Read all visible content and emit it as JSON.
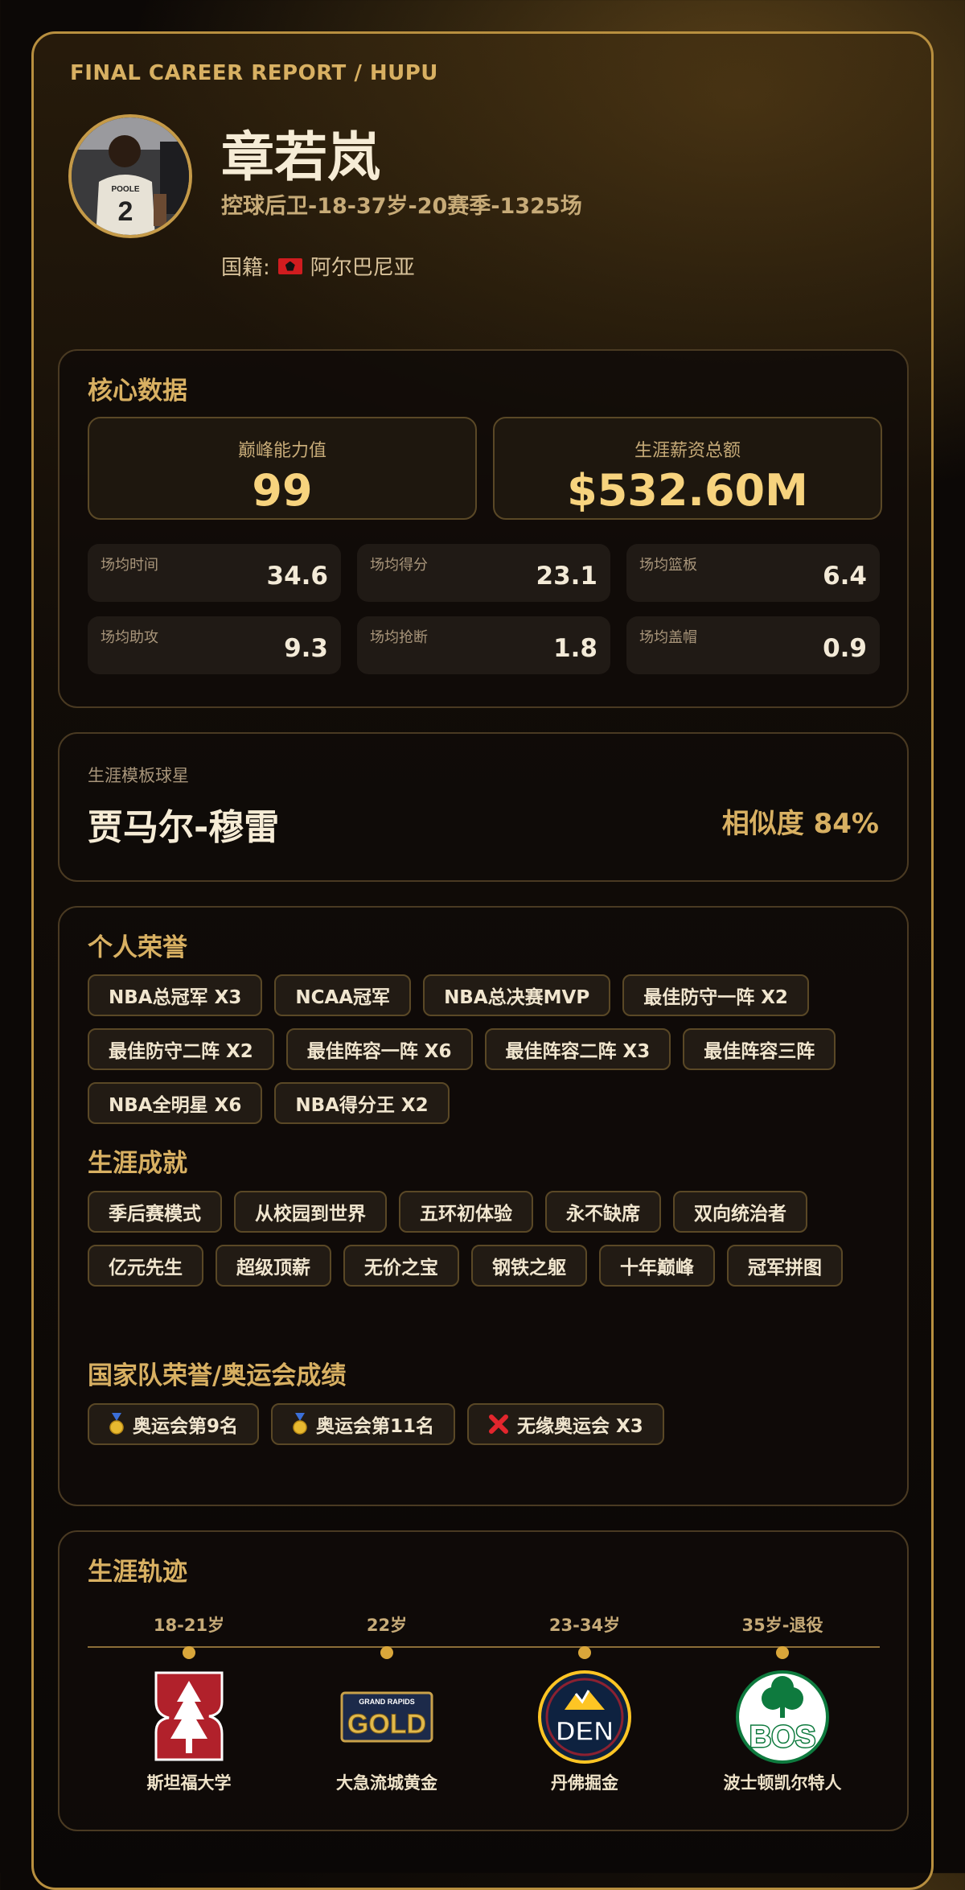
{
  "header": {
    "kicker": "FINAL CAREER REPORT / HUPU",
    "player_name": "章若岚",
    "subtitle": "控球后卫-18-37岁-20赛季-1325场",
    "nationality_label": "国籍:",
    "nationality": "阿尔巴尼亚",
    "avatar_jersey_name": "POOLE",
    "avatar_jersey_number": "2"
  },
  "core": {
    "title": "核心数据",
    "peak_label": "巅峰能力值",
    "peak_value": "99",
    "salary_label": "生涯薪资总额",
    "salary_value": "$532.60M",
    "stats": [
      {
        "label": "场均时间",
        "value": "34.6"
      },
      {
        "label": "场均得分",
        "value": "23.1"
      },
      {
        "label": "场均篮板",
        "value": "6.4"
      },
      {
        "label": "场均助攻",
        "value": "9.3"
      },
      {
        "label": "场均抢断",
        "value": "1.8"
      },
      {
        "label": "场均盖帽",
        "value": "0.9"
      }
    ]
  },
  "template": {
    "label": "生涯模板球星",
    "player": "贾马尔-穆雷",
    "similarity": "相似度 84%"
  },
  "honors": {
    "title": "个人荣誉",
    "items": [
      "NBA总冠军 X3",
      "NCAA冠军",
      "NBA总决赛MVP",
      "最佳防守一阵 X2",
      "最佳防守二阵 X2",
      "最佳阵容一阵 X6",
      "最佳阵容二阵 X3",
      "最佳阵容三阵",
      "NBA全明星 X6",
      "NBA得分王 X2"
    ]
  },
  "achievements": {
    "title": "生涯成就",
    "items": [
      "季后赛模式",
      "从校园到世界",
      "五环初体验",
      "永不缺席",
      "双向统治者",
      "亿元先生",
      "超级顶薪",
      "无价之宝",
      "钢铁之躯",
      "十年巅峰",
      "冠军拼图"
    ]
  },
  "national": {
    "title": "国家队荣誉/奥运会成绩",
    "items": [
      {
        "icon": "medal-icon",
        "text": "奥运会第9名"
      },
      {
        "icon": "medal-icon",
        "text": "奥运会第11名"
      },
      {
        "icon": "cross-icon",
        "text": "无缘奥运会 X3"
      }
    ]
  },
  "career": {
    "title": "生涯轨迹",
    "stops": [
      {
        "age": "18-21岁",
        "team": "斯坦福大学",
        "logo": "stanford-logo",
        "logo_text": "S"
      },
      {
        "age": "22岁",
        "team": "大急流城黄金",
        "logo": "grand-rapids-gold-logo",
        "logo_text": "GOLD",
        "logo_subtext": "GRAND RAPIDS"
      },
      {
        "age": "23-34岁",
        "team": "丹佛掘金",
        "logo": "denver-nuggets-logo",
        "logo_text": "DEN"
      },
      {
        "age": "35岁-退役",
        "team": "波士顿凯尔特人",
        "logo": "boston-celtics-logo",
        "logo_text": "BOS"
      }
    ]
  },
  "colors": {
    "accent": "#d8b062",
    "border": "#b88f3f",
    "value": "#f7d37e",
    "cardinal": "#b1212b",
    "celtics": "#0e7a3e"
  }
}
